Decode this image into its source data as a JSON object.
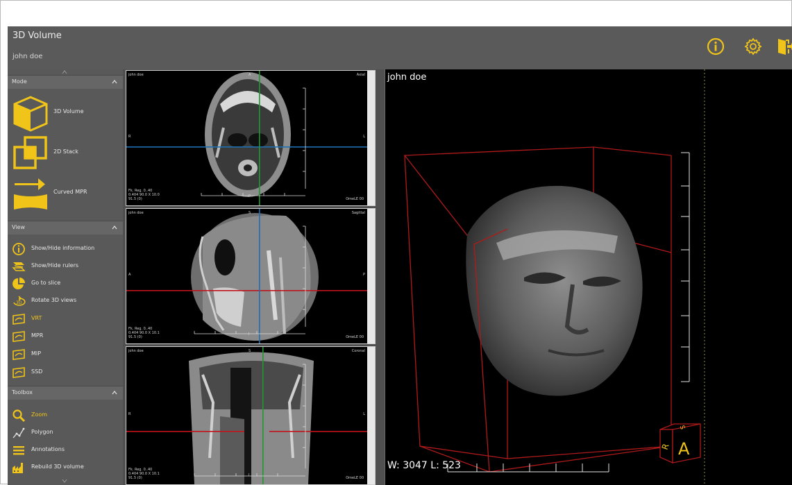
{
  "header": {
    "title": "3D Volume",
    "patient": "john doe",
    "icons": [
      "info-icon",
      "gear-icon",
      "exit-icon"
    ]
  },
  "sidebar": {
    "mode": {
      "title": "Mode",
      "items": [
        {
          "label": "3D Volume",
          "icon": "cube-icon"
        },
        {
          "label": "2D Stack",
          "icon": "stack-icon"
        },
        {
          "label": "Curved MPR",
          "icon": "curved-mpr-icon"
        }
      ]
    },
    "view": {
      "title": "View",
      "items": [
        {
          "label": "Show/Hide information",
          "icon": "info-icon"
        },
        {
          "label": "Show/Hide rulers",
          "icon": "ruler-icon"
        },
        {
          "label": "Go to slice",
          "icon": "pie-icon"
        },
        {
          "label": "Rotate 3D views",
          "icon": "rotate-3d-icon"
        },
        {
          "label": "VRT",
          "icon": "render-icon",
          "active": true
        },
        {
          "label": "MPR",
          "icon": "render-icon"
        },
        {
          "label": "MIP",
          "icon": "render-icon"
        },
        {
          "label": "SSD",
          "icon": "render-icon"
        }
      ]
    },
    "toolbox": {
      "title": "Toolbox",
      "items": [
        {
          "label": "Zoom",
          "icon": "magnifier-icon",
          "active": true
        },
        {
          "label": "Polygon",
          "icon": "polygon-icon"
        },
        {
          "label": "Annotations",
          "icon": "annotations-icon"
        },
        {
          "label": "Rebuild 3D volume",
          "icon": "rebuild-icon"
        }
      ]
    }
  },
  "slices": [
    {
      "name": "axial",
      "patient": "john doe",
      "top": "A",
      "right": "Axial",
      "left": "R",
      "side": "L",
      "bottom": "P",
      "info": "Fk. Reg. 0..40\n0.404 90.0 X 10.0\n91.5 (0)",
      "stamp": "OmeLE 00"
    },
    {
      "name": "sagittal",
      "patient": "john doe",
      "top": "S",
      "right": "Sagittal",
      "left": "A",
      "side": "P",
      "bottom": "I",
      "info": "Fk. Reg. 0..40\n0.404 90.0 X 10.1\n91.5 (0)",
      "stamp": "OmeLE 00"
    },
    {
      "name": "coronal",
      "patient": "john doe",
      "top": "S",
      "right": "Coronal",
      "left": "R",
      "side": "L",
      "bottom": "I",
      "info": "Fk. Reg. 0..40\n0.404 90.0 X 10.1\n91.5 (0)",
      "stamp": "OmeLE 00"
    }
  ],
  "view3d": {
    "patient": "john doe",
    "wl": "W: 3047 L: 523",
    "orientation_cube": {
      "front": "A",
      "side": "R",
      "top": "S"
    }
  },
  "colors": {
    "accent": "#f0c419",
    "crosshair_red": "#c0141a",
    "crosshair_blue": "#1e6eb4",
    "crosshair_green": "#1f9a2c",
    "bbox": "#b01a1a"
  }
}
